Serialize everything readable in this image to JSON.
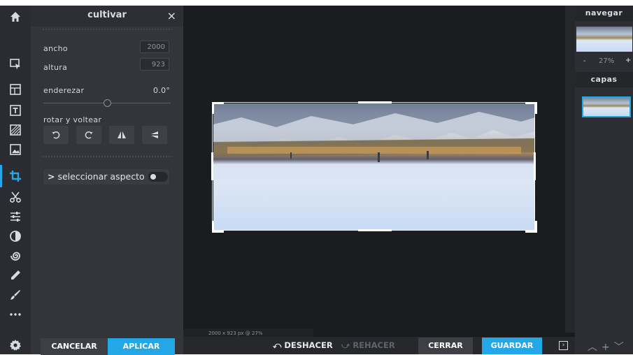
{
  "panel": {
    "title": "cultivar",
    "close": "×",
    "width_label": "ancho",
    "width_value": "2000",
    "height_label": "altura",
    "height_value": "923",
    "straighten_label": "enderezar",
    "straighten_value": "0.0°",
    "rotate_flip_label": "rotar y voltear",
    "aspect_label": "seleccionar aspecto",
    "aspect_chevron": ">",
    "cancel": "CANCELAR",
    "apply": "APLICAR"
  },
  "canvas": {
    "info": "2000 x 923 px @ 27%"
  },
  "bottom": {
    "undo": "DESHACER",
    "redo": "REHACER",
    "close": "CERRAR",
    "save": "GUARDAR"
  },
  "right": {
    "navigate": "navegar",
    "zoom_minus": "-",
    "zoom_value": "27%",
    "zoom_plus": "+",
    "layers": "capas"
  },
  "colors": {
    "accent": "#23a7e6",
    "toolbar_bg": "#2a2c31",
    "panel_bg": "#33353a",
    "canvas_bg": "#1b1c1f"
  },
  "toolbar_icons": [
    "home-icon",
    "arrange-icon",
    "layout-icon",
    "text-icon",
    "texture-icon",
    "image-icon",
    "crop-icon",
    "cut-icon",
    "adjust-icon",
    "filter-icon",
    "liquify-icon",
    "retouch-icon",
    "draw-icon",
    "more-icon",
    "settings-icon"
  ]
}
